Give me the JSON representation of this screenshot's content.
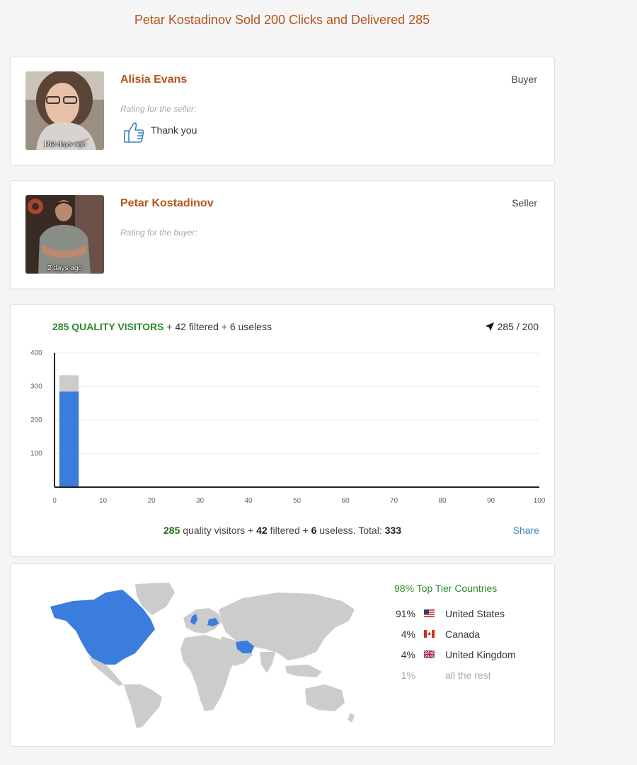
{
  "header": {
    "title": "Petar Kostadinov Sold 200 Clicks and Delivered 285"
  },
  "buyer_review": {
    "name": "Alisia Evans",
    "role": "Buyer",
    "age": "182 days ago",
    "rating_label": "Rating for the seller:",
    "comment": "Thank you",
    "rating_icon": "thumbs-up-icon"
  },
  "seller_review": {
    "name": "Petar Kostadinov",
    "role": "Seller",
    "age": "2 days ago",
    "rating_label": "Rating for the buyer:"
  },
  "traffic": {
    "headline_green": "285 QUALITY VISITORS",
    "headline_rest": " + 42 filtered + 6 useless",
    "ratio": "285 / 200",
    "ratio_icon": "location-arrow-icon",
    "summary": {
      "quality": "285",
      "quality_text": " quality visitors + ",
      "filtered": "42",
      "filtered_text": " filtered + ",
      "useless": "6",
      "useless_text": " useless. Total: ",
      "total": "333"
    },
    "share_label": "Share"
  },
  "chart_data": {
    "type": "bar",
    "stacked": true,
    "x_ticks": [
      "0",
      "10",
      "20",
      "30",
      "40",
      "50",
      "60",
      "70",
      "80",
      "90",
      "100"
    ],
    "y_ticks": [
      "100",
      "200",
      "300",
      "400"
    ],
    "xlim": [
      0,
      100
    ],
    "ylim": [
      0,
      400
    ],
    "bars": [
      {
        "x": 3,
        "quality": 285,
        "filtered_useless": 48
      }
    ],
    "colors": {
      "quality": "#3b7ddd",
      "other": "#cccccc"
    },
    "grid": true
  },
  "geo": {
    "top_tier_label": "98% Top Tier Countries",
    "countries": [
      {
        "pct": "91%",
        "name": "United States",
        "flag": "us-flag-icon"
      },
      {
        "pct": "4%",
        "name": "Canada",
        "flag": "ca-flag-icon"
      },
      {
        "pct": "4%",
        "name": "United Kingdom",
        "flag": "uk-flag-icon"
      },
      {
        "pct": "1%",
        "name": "all the rest",
        "flag": ""
      }
    ],
    "colors": {
      "highlight": "#3b7ddd",
      "land": "#cccccc"
    }
  }
}
